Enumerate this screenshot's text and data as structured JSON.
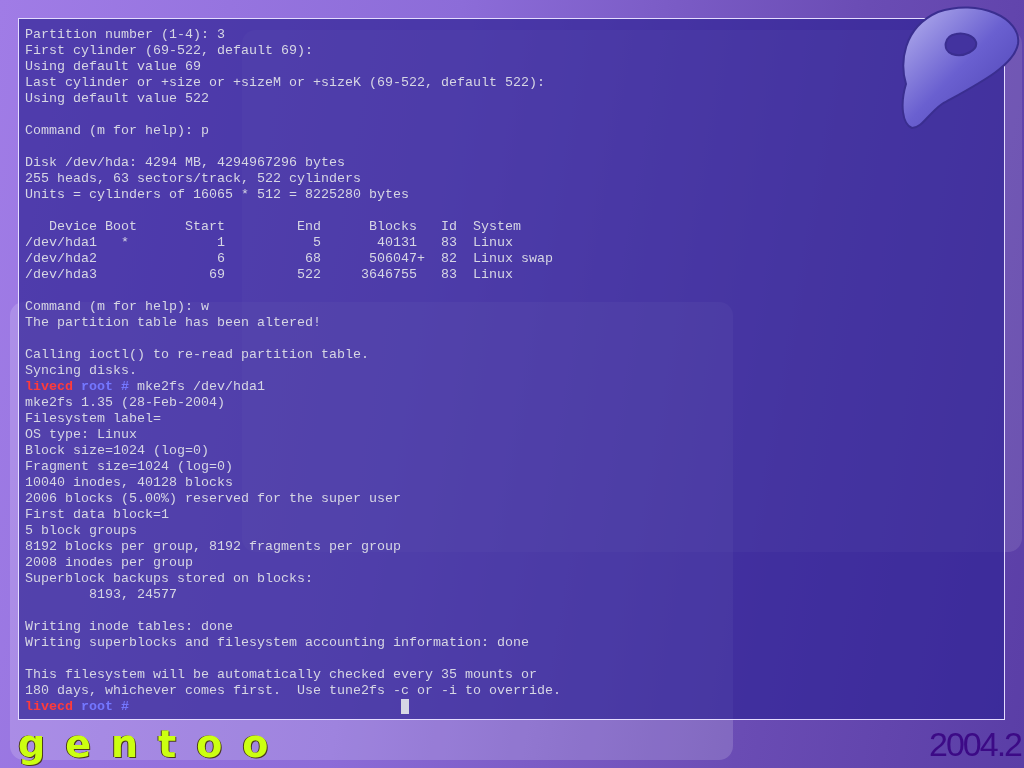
{
  "terminal": {
    "lines": [
      {
        "kind": "text",
        "text": "Partition number (1-4): 3"
      },
      {
        "kind": "text",
        "text": "First cylinder (69-522, default 69):"
      },
      {
        "kind": "text",
        "text": "Using default value 69"
      },
      {
        "kind": "text",
        "text": "Last cylinder or +size or +sizeM or +sizeK (69-522, default 522):"
      },
      {
        "kind": "text",
        "text": "Using default value 522"
      },
      {
        "kind": "blank"
      },
      {
        "kind": "text",
        "text": "Command (m for help): p"
      },
      {
        "kind": "blank"
      },
      {
        "kind": "text",
        "text": "Disk /dev/hda: 4294 MB, 4294967296 bytes"
      },
      {
        "kind": "text",
        "text": "255 heads, 63 sectors/track, 522 cylinders"
      },
      {
        "kind": "text",
        "text": "Units = cylinders of 16065 * 512 = 8225280 bytes"
      },
      {
        "kind": "blank"
      },
      {
        "kind": "text",
        "text": "   Device Boot      Start         End      Blocks   Id  System"
      },
      {
        "kind": "text",
        "text": "/dev/hda1   *           1           5       40131   83  Linux"
      },
      {
        "kind": "text",
        "text": "/dev/hda2               6          68      506047+  82  Linux swap"
      },
      {
        "kind": "text",
        "text": "/dev/hda3              69         522     3646755   83  Linux"
      },
      {
        "kind": "blank"
      },
      {
        "kind": "text",
        "text": "Command (m for help): w"
      },
      {
        "kind": "text",
        "text": "The partition table has been altered!"
      },
      {
        "kind": "blank"
      },
      {
        "kind": "text",
        "text": "Calling ioctl() to re-read partition table."
      },
      {
        "kind": "text",
        "text": "Syncing disks."
      },
      {
        "kind": "prompt",
        "host": "livecd",
        "user": "root",
        "symbol": "#",
        "command": "mke2fs /dev/hda1"
      },
      {
        "kind": "text",
        "text": "mke2fs 1.35 (28-Feb-2004)"
      },
      {
        "kind": "text",
        "text": "Filesystem label="
      },
      {
        "kind": "text",
        "text": "OS type: Linux"
      },
      {
        "kind": "text",
        "text": "Block size=1024 (log=0)"
      },
      {
        "kind": "text",
        "text": "Fragment size=1024 (log=0)"
      },
      {
        "kind": "text",
        "text": "10040 inodes, 40128 blocks"
      },
      {
        "kind": "text",
        "text": "2006 blocks (5.00%) reserved for the super user"
      },
      {
        "kind": "text",
        "text": "First data block=1"
      },
      {
        "kind": "text",
        "text": "5 block groups"
      },
      {
        "kind": "text",
        "text": "8192 blocks per group, 8192 fragments per group"
      },
      {
        "kind": "text",
        "text": "2008 inodes per group"
      },
      {
        "kind": "text",
        "text": "Superblock backups stored on blocks:"
      },
      {
        "kind": "text",
        "text": "        8193, 24577"
      },
      {
        "kind": "blank"
      },
      {
        "kind": "text",
        "text": "Writing inode tables: done"
      },
      {
        "kind": "text",
        "text": "Writing superblocks and filesystem accounting information: done"
      },
      {
        "kind": "blank"
      },
      {
        "kind": "text",
        "text": "This filesystem will be automatically checked every 35 mounts or"
      },
      {
        "kind": "text",
        "text": "180 days, whichever comes first.  Use tune2fs -c or -i to override."
      },
      {
        "kind": "prompt",
        "host": "livecd",
        "user": "root",
        "symbol": "#",
        "cursor": true
      }
    ]
  },
  "branding": {
    "logo_text": "gentoo",
    "version": "2004.2"
  }
}
